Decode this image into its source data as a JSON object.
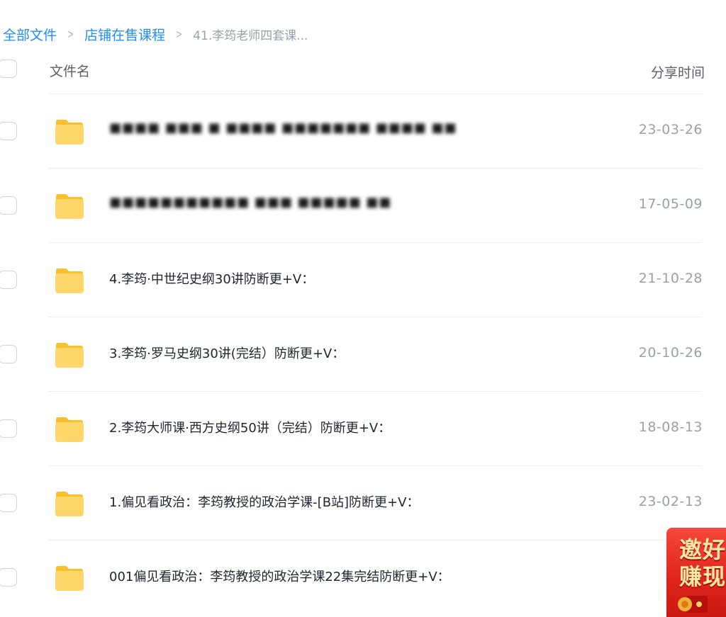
{
  "breadcrumb": {
    "root": "全部文件",
    "parent": "店铺在售课程",
    "current": "41.李筠老师四套课...",
    "separator": ">"
  },
  "table_header": {
    "name_label": "文件名",
    "time_label": "分享时间"
  },
  "files": [
    {
      "name": "■■■■ ■■■ ■ ■■■■ ■■■■■■■ ■■■■  ■■",
      "date": "23-03-26",
      "blurred": true
    },
    {
      "name": "■■■■■■■■■■■ ■■■   ■■■■■  ■■",
      "date": "17-05-09",
      "blurred": true
    },
    {
      "name": "4.李筠·中世纪史纲30讲防断更+V：",
      "date": "21-10-28",
      "blurred": false
    },
    {
      "name": "3.李筠·罗马史纲30讲(完结）防断更+V：",
      "date": "20-10-26",
      "blurred": false
    },
    {
      "name": "2.李筠大师课·西方史纲50讲（完结）防断更+V：",
      "date": "18-08-13",
      "blurred": false
    },
    {
      "name": "1.偏见看政治：李筠教授的政治学课-[B站]防断更+V：",
      "date": "23-02-13",
      "blurred": false
    },
    {
      "name": "001偏见看政治：李筠教授的政治学课22集完结防断更+V：",
      "date": "23-0",
      "blurred": false
    }
  ],
  "promo": {
    "line1": "邀好",
    "line2": "赚现"
  },
  "colors": {
    "link": "#1f8cff",
    "folder_light": "#ffd66a",
    "folder_dark": "#f7c02c",
    "promo_red": "#e0251d"
  },
  "icons": {
    "folder": "folder-icon",
    "separator": "chevron-right-icon"
  }
}
